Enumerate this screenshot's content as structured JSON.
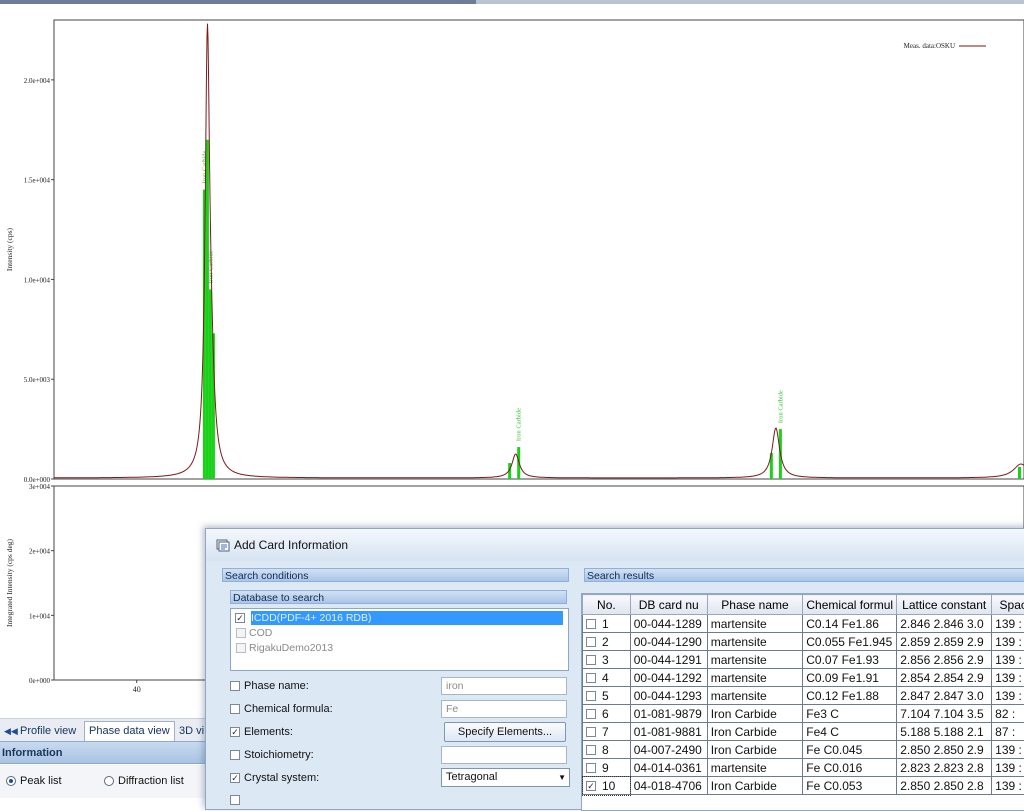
{
  "chart_data": [
    {
      "type": "line",
      "title": "",
      "ylabel": "Intensity (cps)",
      "ylim": [
        0,
        23000
      ],
      "y_ticks": [
        "0.0e+000",
        "5.0e+003",
        "1.0e+004",
        "1.5e+004",
        "2.0e+004"
      ],
      "y_tick_values": [
        0,
        5000,
        10000,
        15000,
        20000
      ],
      "xlim": [
        34.5,
        99
      ],
      "legend": "top-right",
      "series": [
        {
          "name": "Meas. data:OSKU",
          "color": "#7a1a1a",
          "peaks": [
            {
              "x": 44.7,
              "height": 21000,
              "width": 0.18
            },
            {
              "x": 44.95,
              "height": 3500,
              "width": 0.25
            },
            {
              "x": 65.2,
              "height": 1200,
              "width": 0.3
            },
            {
              "x": 82.5,
              "height": 2500,
              "width": 0.3
            },
            {
              "x": 98.8,
              "height": 700,
              "width": 0.6
            }
          ],
          "baseline": 50
        }
      ],
      "reference_sticks": [
        {
          "x": 44.5,
          "y": 14500,
          "label": "Iron Carbide"
        },
        {
          "x": 44.7,
          "y": 17000,
          "label": ""
        },
        {
          "x": 44.9,
          "y": 9500,
          "label": "Iron Carbide"
        },
        {
          "x": 45.1,
          "y": 7300,
          "label": ""
        },
        {
          "x": 64.8,
          "y": 800,
          "label": ""
        },
        {
          "x": 65.4,
          "y": 1600,
          "label": "Iron Carbide"
        },
        {
          "x": 82.2,
          "y": 1300,
          "label": ""
        },
        {
          "x": 82.8,
          "y": 2500,
          "label": "Iron Carbide"
        },
        {
          "x": 98.7,
          "y": 600,
          "label": ""
        },
        {
          "x": 99.9,
          "y": 300,
          "label": ""
        }
      ],
      "stick_color": "#19d119"
    },
    {
      "type": "line",
      "ylabel": "Integrated Intensity (cps deg)",
      "ylim": [
        0,
        30000
      ],
      "y_ticks": [
        "0e+000",
        "1e+004",
        "2e+004",
        "3e+004"
      ],
      "y_tick_values": [
        0,
        10000,
        20000,
        30000
      ],
      "xlim": [
        34.5,
        99
      ],
      "x_ticks": [
        "40"
      ],
      "x_tick_values": [
        40
      ]
    }
  ],
  "tabs": {
    "arrow": "◀◀",
    "profile": "Profile view",
    "phase": "Phase data view",
    "view3d": "3D vi"
  },
  "info_panel": {
    "title": "Information",
    "peak_list": "Peak list",
    "diffraction_list": "Diffraction list"
  },
  "dialog": {
    "title": "Add Card Information",
    "search_conditions": "Search conditions",
    "database_to_search": "Database to search",
    "databases": [
      {
        "name": "ICDD(PDF-4+ 2016 RDB)",
        "checked": true
      },
      {
        "name": "COD",
        "checked": false
      },
      {
        "name": "RigakuDemo2013",
        "checked": false
      }
    ],
    "phase_name": {
      "label": "Phase name:",
      "value": "iron"
    },
    "chemical_formula": {
      "label": "Chemical formula:",
      "value": "Fe"
    },
    "elements": {
      "label": "Elements:",
      "button": "Specify Elements..."
    },
    "stoichiometry": {
      "label": "Stoichiometry:"
    },
    "crystal_system": {
      "label": "Crystal system:",
      "value": "Tetragonal"
    },
    "search_results": "Search results",
    "columns": [
      "No.",
      "DB card nu",
      "Phase name",
      "Chemical formul",
      "Lattice constant",
      "Space"
    ],
    "rows": [
      {
        "no": "1",
        "card": "00-044-1289",
        "phase": "martensite",
        "formula": "C0.14 Fe1.86",
        "lattice": "2.846 2.846 3.0",
        "space": "139 :",
        "checked": false
      },
      {
        "no": "2",
        "card": "00-044-1290",
        "phase": "martensite",
        "formula": "C0.055 Fe1.945",
        "lattice": "2.859 2.859 2.9",
        "space": "139 :",
        "checked": false
      },
      {
        "no": "3",
        "card": "00-044-1291",
        "phase": "martensite",
        "formula": "C0.07 Fe1.93",
        "lattice": "2.856 2.856 2.9",
        "space": "139 :",
        "checked": false
      },
      {
        "no": "4",
        "card": "00-044-1292",
        "phase": "martensite",
        "formula": "C0.09 Fe1.91",
        "lattice": "2.854 2.854 2.9",
        "space": "139 :",
        "checked": false
      },
      {
        "no": "5",
        "card": "00-044-1293",
        "phase": "martensite",
        "formula": "C0.12 Fe1.88",
        "lattice": "2.847 2.847 3.0",
        "space": "139 :",
        "checked": false
      },
      {
        "no": "6",
        "card": "01-081-9879",
        "phase": "Iron Carbide",
        "formula": "Fe3 C",
        "lattice": "7.104 7.104 3.5",
        "space": "82 :",
        "checked": false
      },
      {
        "no": "7",
        "card": "01-081-9881",
        "phase": "Iron Carbide",
        "formula": "Fe4 C",
        "lattice": "5.188 5.188 2.1",
        "space": "87 :",
        "checked": false
      },
      {
        "no": "8",
        "card": "04-007-2490",
        "phase": "Iron Carbide",
        "formula": "Fe C0.045",
        "lattice": "2.850 2.850 2.9",
        "space": "139 :",
        "checked": false
      },
      {
        "no": "9",
        "card": "04-014-0361",
        "phase": "martensite",
        "formula": "Fe C0.016",
        "lattice": "2.823 2.823 2.8",
        "space": "139 :",
        "checked": false
      },
      {
        "no": "10",
        "card": "04-018-4706",
        "phase": "Iron Carbide",
        "formula": "Fe C0.053",
        "lattice": "2.850 2.850 2.8",
        "space": "139 :",
        "checked": true
      }
    ]
  }
}
